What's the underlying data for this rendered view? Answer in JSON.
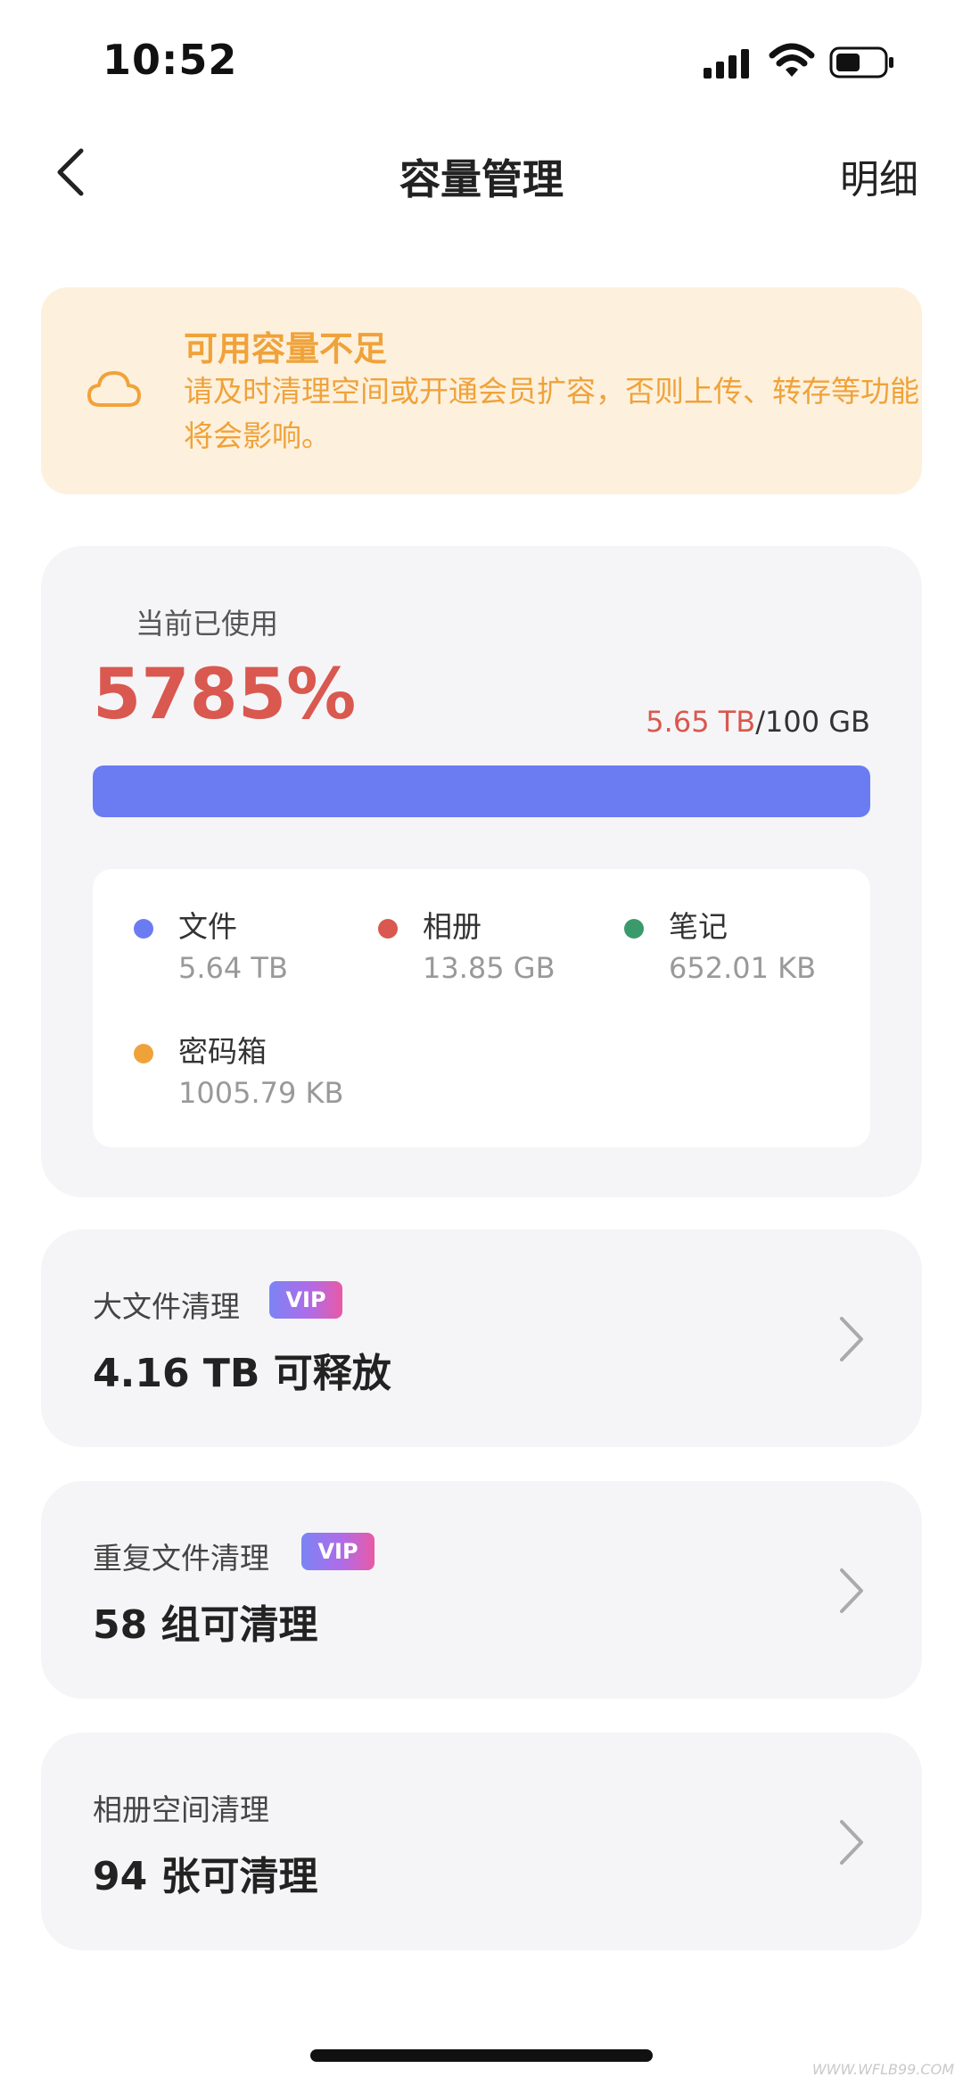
{
  "status_bar": {
    "time": "10:52"
  },
  "nav": {
    "title": "容量管理",
    "detail_label": "明细"
  },
  "warning": {
    "title": "可用容量不足",
    "text": "请及时清理空间或开通会员扩容，否则上传、转存等功能将会影响。",
    "color": "#f0a23a",
    "background": "#fdf1dd"
  },
  "usage": {
    "label": "当前已使用",
    "percent": "5785%",
    "used": "5.65 TB",
    "total": "/100 GB",
    "bar_fill_fraction": 1.0,
    "bar_color": "#6b7cf3",
    "categories": [
      {
        "name": "文件",
        "size": "5.64 TB",
        "color": "#6b7cf3"
      },
      {
        "name": "相册",
        "size": "13.85 GB",
        "color": "#d9584f"
      },
      {
        "name": "笔记",
        "size": "652.01 KB",
        "color": "#3a9a6c"
      },
      {
        "name": "密码箱",
        "size": "1005.79 KB",
        "color": "#f0a23a"
      }
    ]
  },
  "cleanup": [
    {
      "title": "大文件清理",
      "vip": "VIP",
      "main": "4.16 TB 可释放"
    },
    {
      "title": "重复文件清理",
      "vip": "VIP",
      "main": "58 组可清理"
    },
    {
      "title": "相册空间清理",
      "main": "94 张可清理"
    }
  ],
  "watermark": "WWW.WFLB99.COM"
}
